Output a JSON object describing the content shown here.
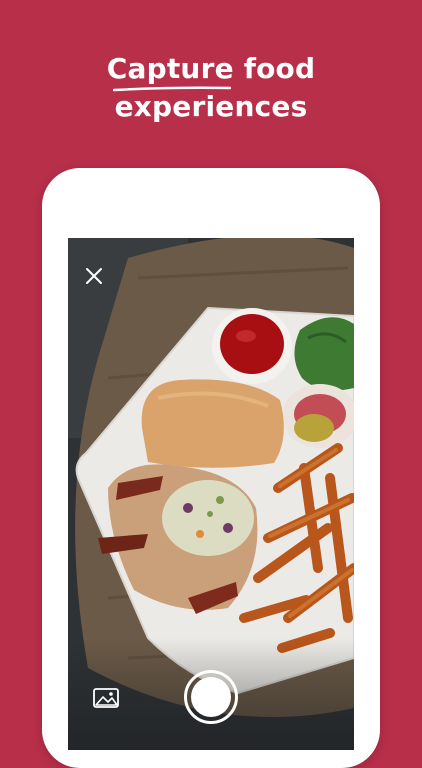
{
  "headline": {
    "line1": "Capture food",
    "line2": "experiences"
  },
  "camera": {
    "close_icon": "close-icon",
    "gallery_icon": "image-gallery-icon",
    "shutter_icon": "shutter-button-icon",
    "preview_subject": "food-photo"
  },
  "colors": {
    "background": "#b82f4a",
    "phone_frame": "#ffffff",
    "text": "#ffffff"
  }
}
